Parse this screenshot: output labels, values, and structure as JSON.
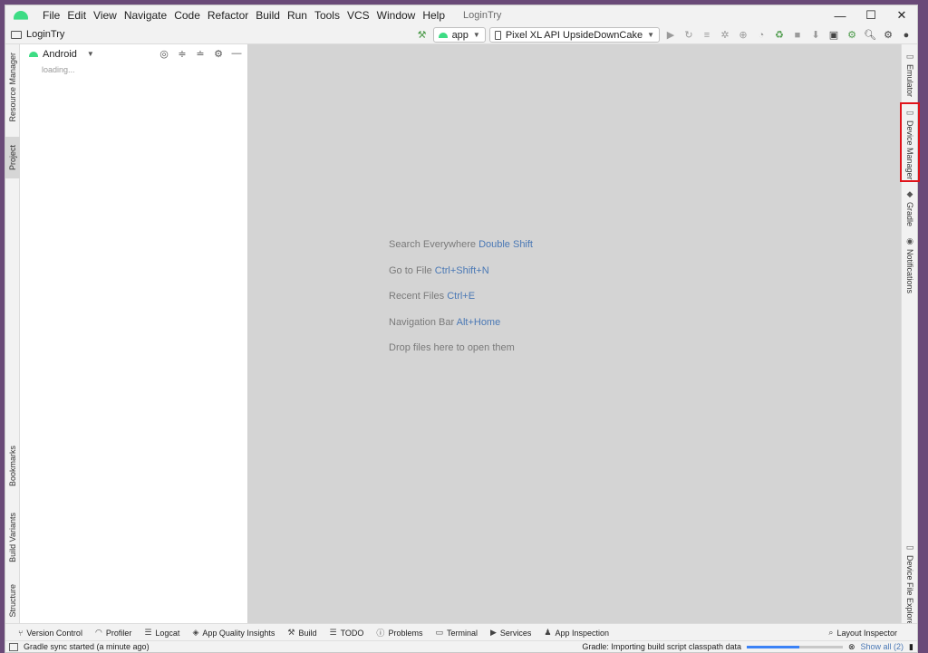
{
  "window": {
    "title": "LoginTry",
    "menu": [
      "File",
      "Edit",
      "View",
      "Navigate",
      "Code",
      "Refactor",
      "Build",
      "Run",
      "Tools",
      "VCS",
      "Window",
      "Help"
    ],
    "controls": {
      "minimize": "—",
      "maximize": "☐",
      "close": "✕"
    }
  },
  "toolbar": {
    "project_name": "LoginTry",
    "run_config": "app",
    "device": "Pixel XL API UpsideDownCake"
  },
  "left_tabs": {
    "resource_manager": "Resource Manager",
    "project": "Project",
    "bookmarks": "Bookmarks",
    "build_variants": "Build Variants",
    "structure": "Structure"
  },
  "project_panel": {
    "view_mode": "Android",
    "loading": "loading..."
  },
  "editor": {
    "hints": [
      {
        "text": "Search Everywhere",
        "key": "Double Shift"
      },
      {
        "text": "Go to File",
        "key": "Ctrl+Shift+N"
      },
      {
        "text": "Recent Files",
        "key": "Ctrl+E"
      },
      {
        "text": "Navigation Bar",
        "key": "Alt+Home"
      },
      {
        "text": "Drop files here to open them",
        "key": ""
      }
    ]
  },
  "right_tabs": {
    "emulator": "Emulator",
    "device_manager": "Device Manager",
    "gradle": "Gradle",
    "notifications": "Notifications",
    "device_file_explorer": "Device File Explorer"
  },
  "bottom_tools": {
    "version_control": "Version Control",
    "profiler": "Profiler",
    "logcat": "Logcat",
    "app_quality": "App Quality Insights",
    "build": "Build",
    "todo": "TODO",
    "problems": "Problems",
    "terminal": "Terminal",
    "services": "Services",
    "app_inspection": "App Inspection",
    "layout_inspector": "Layout Inspector"
  },
  "status": {
    "message": "Gradle sync started (a minute ago)",
    "task": "Gradle: Importing build script classpath data",
    "progress": 0.55,
    "show_all": "Show all (2)"
  },
  "colors": {
    "accent": "#4a78b5",
    "android_green": "#3ddc84",
    "highlight": "#e0141b",
    "editor_bg": "#d4d4d4"
  }
}
